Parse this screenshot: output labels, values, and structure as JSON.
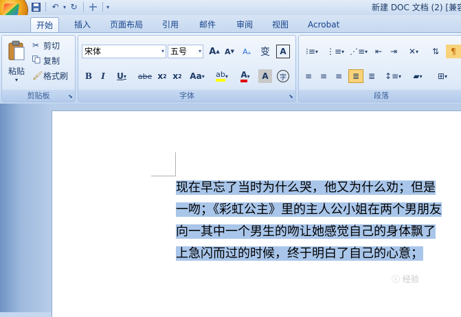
{
  "window": {
    "title": "新建 DOC 文档 (2) [兼容"
  },
  "tabs": [
    {
      "label": "开始"
    },
    {
      "label": "插入"
    },
    {
      "label": "页面布局"
    },
    {
      "label": "引用"
    },
    {
      "label": "邮件"
    },
    {
      "label": "审阅"
    },
    {
      "label": "视图"
    },
    {
      "label": "Acrobat"
    }
  ],
  "clipboard": {
    "paste_label": "粘贴",
    "cut_label": "剪切",
    "copy_label": "复制",
    "format_painter_label": "格式刷",
    "group_label": "剪贴板"
  },
  "font": {
    "font_name": "宋体",
    "font_size": "五号",
    "group_label": "字体"
  },
  "paragraph": {
    "group_label": "段落"
  },
  "document": {
    "lines": [
      "现在早忘了当时为什么哭，他又为什么劝；但是",
      "一吻；《彩虹公主》里的主人公小姐在两个男朋友",
      "向一其中一个男生的吻让她感觉自己的身体飘了",
      "上急闪而过的时候，终于明白了自己的心意；"
    ]
  },
  "watermark": "ⓘ 经验"
}
